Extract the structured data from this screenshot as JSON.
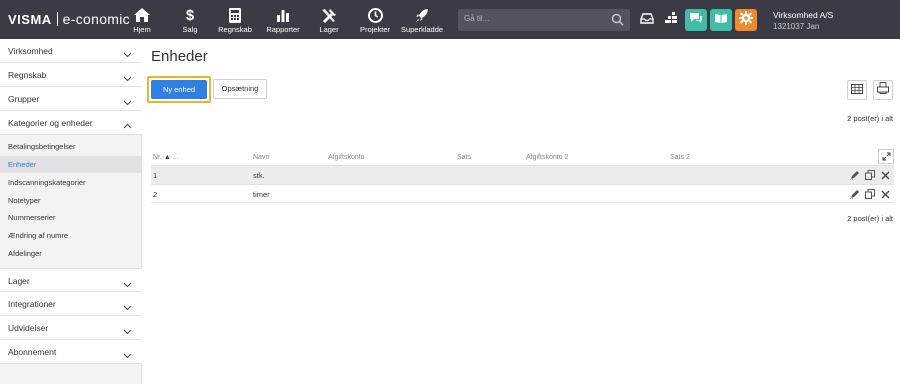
{
  "brand": {
    "name": "VISMA",
    "product": "e-conomic"
  },
  "nav": [
    {
      "label": "Hjem",
      "icon": "home-icon"
    },
    {
      "label": "Salg",
      "icon": "dollar-icon"
    },
    {
      "label": "Regnskab",
      "icon": "calculator-icon"
    },
    {
      "label": "Rapporter",
      "icon": "bar-chart-icon"
    },
    {
      "label": "Lager",
      "icon": "tools-icon"
    },
    {
      "label": "Projekter",
      "icon": "clock-icon"
    },
    {
      "label": "Superkladde",
      "icon": "rocket-icon"
    }
  ],
  "search": {
    "placeholder": "Gå til..."
  },
  "company": {
    "name": "Virksomhed A/S",
    "sub": "1321037 Jan"
  },
  "colors": {
    "topbar": "#3b3b45",
    "primary": "#2f80e2",
    "highlight": "#f0b323",
    "teal": "#3dbfa5",
    "orange": "#ef8a2e"
  },
  "sidebar": {
    "groups_top": [
      {
        "label": "Virksomhed"
      },
      {
        "label": "Regnskab"
      },
      {
        "label": "Grupper"
      },
      {
        "label": "Kategorier og enheder"
      }
    ],
    "sub_items": [
      {
        "label": "Betalingsbetingelser"
      },
      {
        "label": "Enheder"
      },
      {
        "label": "Indscanningskategorier"
      },
      {
        "label": "Notetyper"
      },
      {
        "label": "Nummerserier"
      },
      {
        "label": "Ændring af numre"
      },
      {
        "label": "Afdelinger"
      }
    ],
    "groups_bottom": [
      {
        "label": "Lager"
      },
      {
        "label": "Integrationer"
      },
      {
        "label": "Udvidelser"
      },
      {
        "label": "Abonnement"
      }
    ]
  },
  "main": {
    "title": "Enheder",
    "new_button": "Ny enhed",
    "setup_button": "Opsætning",
    "count_top": "2 post(er) i alt",
    "count_bottom": "2 post(er) i alt",
    "columns": [
      "Nr.",
      "Navn",
      "Afgiftskonto",
      "Sats",
      "Afgiftskonto 2",
      "Sats 2"
    ],
    "rows": [
      {
        "nr": "1",
        "navn": "stk."
      },
      {
        "nr": "2",
        "navn": "timer"
      }
    ]
  }
}
